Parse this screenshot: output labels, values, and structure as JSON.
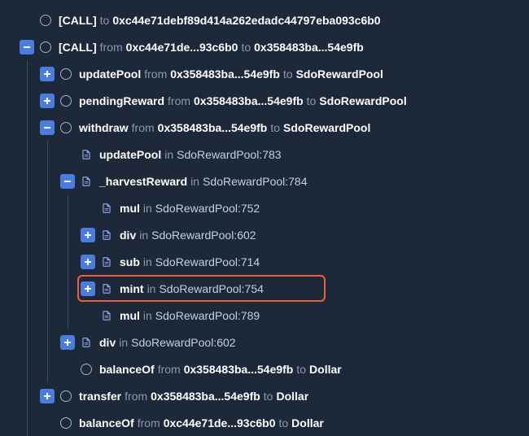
{
  "rows": [
    {
      "depth": 0,
      "expander": "none",
      "icon": "circle",
      "parts": [
        {
          "t": "fname",
          "v": "[CALL]"
        },
        {
          "t": "kw",
          "v": "to"
        },
        {
          "t": "addr",
          "v": "0xc44e71debf89d414a262edadc44797eba093c6b0"
        }
      ]
    },
    {
      "depth": 0,
      "expander": "minus",
      "icon": "circle",
      "parts": [
        {
          "t": "fname",
          "v": "[CALL]"
        },
        {
          "t": "kw",
          "v": "from"
        },
        {
          "t": "addr",
          "v": "0xc44e71de...93c6b0"
        },
        {
          "t": "kw",
          "v": "to"
        },
        {
          "t": "addr",
          "v": "0x358483ba...54e9fb"
        }
      ]
    },
    {
      "depth": 1,
      "expander": "plus",
      "icon": "circle",
      "parts": [
        {
          "t": "fname",
          "v": "updatePool"
        },
        {
          "t": "kw",
          "v": "from"
        },
        {
          "t": "addr",
          "v": "0x358483ba...54e9fb"
        },
        {
          "t": "kw",
          "v": "to"
        },
        {
          "t": "addr",
          "v": "SdoRewardPool"
        }
      ]
    },
    {
      "depth": 1,
      "expander": "plus",
      "icon": "circle",
      "parts": [
        {
          "t": "fname",
          "v": "pendingReward"
        },
        {
          "t": "kw",
          "v": "from"
        },
        {
          "t": "addr",
          "v": "0x358483ba...54e9fb"
        },
        {
          "t": "kw",
          "v": "to"
        },
        {
          "t": "addr",
          "v": "SdoRewardPool"
        }
      ]
    },
    {
      "depth": 1,
      "expander": "minus",
      "icon": "circle",
      "parts": [
        {
          "t": "fname",
          "v": "withdraw"
        },
        {
          "t": "kw",
          "v": "from"
        },
        {
          "t": "addr",
          "v": "0x358483ba...54e9fb"
        },
        {
          "t": "kw",
          "v": "to"
        },
        {
          "t": "addr",
          "v": "SdoRewardPool"
        }
      ]
    },
    {
      "depth": 2,
      "expander": "none",
      "icon": "file",
      "parts": [
        {
          "t": "fname",
          "v": "updatePool"
        },
        {
          "t": "kw",
          "v": "in"
        },
        {
          "t": "loc",
          "v": "SdoRewardPool:783"
        }
      ]
    },
    {
      "depth": 2,
      "expander": "minus",
      "icon": "file",
      "parts": [
        {
          "t": "fname",
          "v": "_harvestReward"
        },
        {
          "t": "kw",
          "v": "in"
        },
        {
          "t": "loc",
          "v": "SdoRewardPool:784"
        }
      ]
    },
    {
      "depth": 3,
      "expander": "none",
      "icon": "file",
      "parts": [
        {
          "t": "fname",
          "v": "mul"
        },
        {
          "t": "kw",
          "v": "in"
        },
        {
          "t": "loc",
          "v": "SdoRewardPool:752"
        }
      ]
    },
    {
      "depth": 3,
      "expander": "plus",
      "icon": "file",
      "parts": [
        {
          "t": "fname",
          "v": "div"
        },
        {
          "t": "kw",
          "v": "in"
        },
        {
          "t": "loc",
          "v": "SdoRewardPool:602"
        }
      ]
    },
    {
      "depth": 3,
      "expander": "plus",
      "icon": "file",
      "parts": [
        {
          "t": "fname",
          "v": "sub"
        },
        {
          "t": "kw",
          "v": "in"
        },
        {
          "t": "loc",
          "v": "SdoRewardPool:714"
        }
      ]
    },
    {
      "depth": 3,
      "expander": "plus",
      "icon": "file",
      "parts": [
        {
          "t": "fname",
          "v": "mint"
        },
        {
          "t": "kw",
          "v": "in"
        },
        {
          "t": "loc",
          "v": "SdoRewardPool:754"
        }
      ],
      "highlight": true
    },
    {
      "depth": 3,
      "expander": "none",
      "icon": "file",
      "parts": [
        {
          "t": "fname",
          "v": "mul"
        },
        {
          "t": "kw",
          "v": "in"
        },
        {
          "t": "loc",
          "v": "SdoRewardPool:789"
        }
      ]
    },
    {
      "depth": 2,
      "expander": "plus",
      "icon": "file",
      "parts": [
        {
          "t": "fname",
          "v": "div"
        },
        {
          "t": "kw",
          "v": "in"
        },
        {
          "t": "loc",
          "v": "SdoRewardPool:602"
        }
      ]
    },
    {
      "depth": 2,
      "expander": "none",
      "icon": "circle",
      "parts": [
        {
          "t": "fname",
          "v": "balanceOf"
        },
        {
          "t": "kw",
          "v": "from"
        },
        {
          "t": "addr",
          "v": "0x358483ba...54e9fb"
        },
        {
          "t": "kw",
          "v": "to"
        },
        {
          "t": "addr",
          "v": "Dollar"
        }
      ]
    },
    {
      "depth": 1,
      "expander": "plus",
      "icon": "circle",
      "parts": [
        {
          "t": "fname",
          "v": "transfer"
        },
        {
          "t": "kw",
          "v": "from"
        },
        {
          "t": "addr",
          "v": "0x358483ba...54e9fb"
        },
        {
          "t": "kw",
          "v": "to"
        },
        {
          "t": "addr",
          "v": "Dollar"
        }
      ]
    },
    {
      "depth": 1,
      "expander": "none",
      "icon": "circle",
      "parts": [
        {
          "t": "fname",
          "v": "balanceOf"
        },
        {
          "t": "kw",
          "v": "from"
        },
        {
          "t": "addr",
          "v": "0xc44e71de...93c6b0"
        },
        {
          "t": "kw",
          "v": "to"
        },
        {
          "t": "addr",
          "v": "Dollar"
        }
      ]
    }
  ],
  "indentWidth": 25,
  "baseLeft": 14
}
